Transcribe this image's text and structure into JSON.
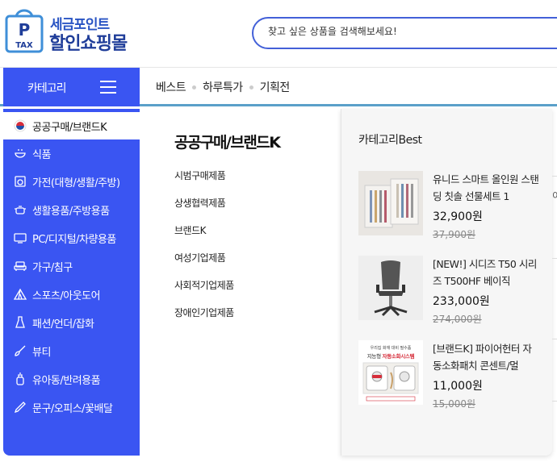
{
  "header": {
    "logo_badge_top": "P",
    "logo_badge_bottom": "TAX",
    "logo_line1": "세금포인트",
    "logo_line2": "할인쇼핑몰",
    "search_placeholder": "찾고 싶은 상품을 검색해보세요!"
  },
  "nav": {
    "category_label": "카테고리",
    "links": [
      "베스트",
      "하루특가",
      "기획전"
    ]
  },
  "sidemenu": {
    "items": [
      {
        "label": "공공구매/브랜드K",
        "icon": "korea-flag-icon"
      },
      {
        "label": "식품",
        "icon": "food-bowl-icon"
      },
      {
        "label": "가전(대형/생활/주방)",
        "icon": "appliance-icon"
      },
      {
        "label": "생활용품/주방용품",
        "icon": "pot-icon"
      },
      {
        "label": "PC/디지털/차량용품",
        "icon": "monitor-icon"
      },
      {
        "label": "가구/침구",
        "icon": "sofa-icon"
      },
      {
        "label": "스포츠/아웃도어",
        "icon": "tent-icon"
      },
      {
        "label": "패션/언더/잡화",
        "icon": "clothes-icon"
      },
      {
        "label": "뷰티",
        "icon": "brush-icon"
      },
      {
        "label": "유아동/반려용품",
        "icon": "bottle-icon"
      },
      {
        "label": "문구/오피스/꽃배달",
        "icon": "pen-icon"
      }
    ]
  },
  "subpanel": {
    "title": "공공구매/브랜드K",
    "items": [
      "시범구매제품",
      "상생협력제품",
      "브랜드K",
      "여성기업제품",
      "사회적기업제품",
      "장애인기업제품"
    ]
  },
  "best": {
    "title": "카테고리Best",
    "products": [
      {
        "name": "유니드 스마트 올인원 스탠딩 칫솔 선물세트 1",
        "price": "32,900원",
        "old_price": "37,900원"
      },
      {
        "name": "[NEW!] 시디즈 T50 시리즈 T500HF 베이직",
        "price": "233,000원",
        "old_price": "274,000원"
      },
      {
        "name": "[브랜드K] 파이어헌터 자동소화패치 콘센트/멀",
        "price": "11,000원",
        "old_price": "15,000원"
      }
    ],
    "thumb3_text1": "우리집 화재 대비 필수품",
    "thumb3_text2": "지능형",
    "thumb3_text3": "자동소화시스템"
  },
  "background": {
    "peek_text": "이"
  },
  "colors": {
    "accent_blue": "#3a55f2",
    "logo_blue": "#2a55c4",
    "search_border": "#4360d8"
  }
}
